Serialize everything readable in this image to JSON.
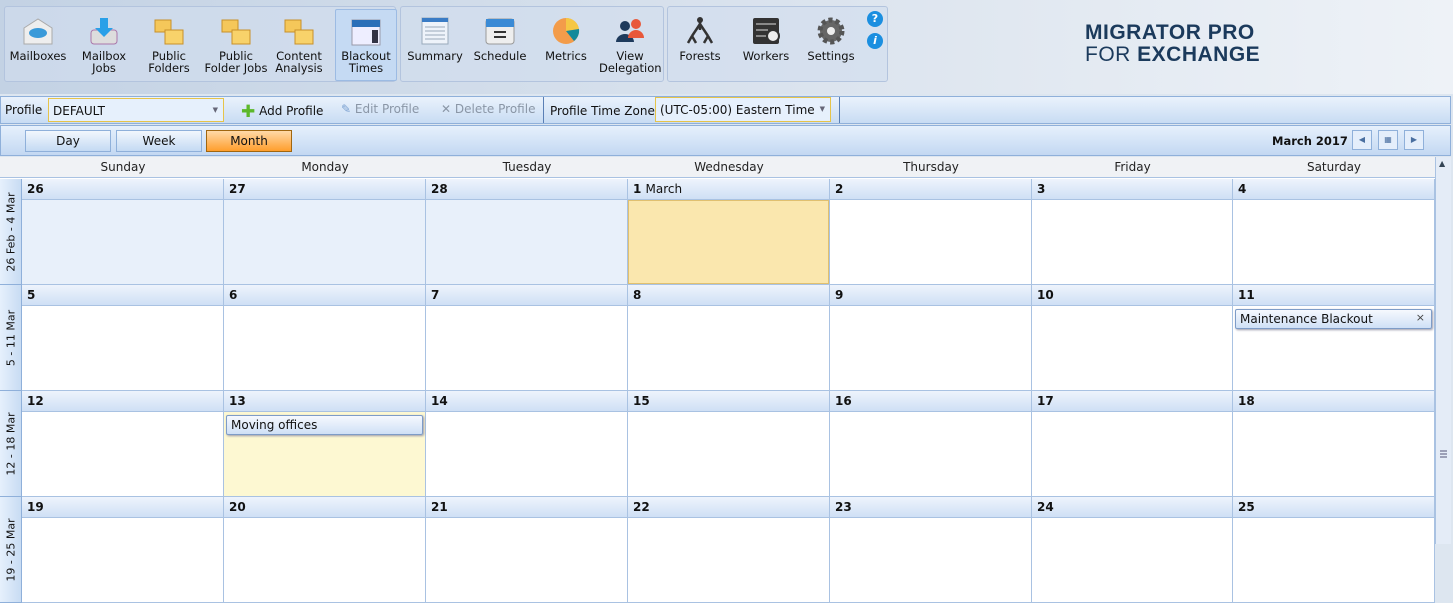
{
  "toolbar": {
    "groups": [
      [
        {
          "label": "Mailboxes",
          "icon": "mailbox-icon"
        },
        {
          "label": "Mailbox Jobs",
          "icon": "mailbox-jobs-icon"
        },
        {
          "label": "Public Folders",
          "icon": "public-folders-icon"
        },
        {
          "label": "Public Folder Jobs",
          "icon": "public-folder-jobs-icon"
        },
        {
          "label": "Content Analysis",
          "icon": "content-analysis-icon"
        },
        {
          "label": "Blackout Times",
          "icon": "calendar-icon",
          "active": true
        }
      ],
      [
        {
          "label": "Summary",
          "icon": "summary-icon"
        },
        {
          "label": "Schedule",
          "icon": "schedule-icon"
        },
        {
          "label": "Metrics",
          "icon": "pie-chart-icon"
        },
        {
          "label": "View Delegation",
          "icon": "users-icon"
        }
      ],
      [
        {
          "label": "Forests",
          "icon": "forest-tree-icon"
        },
        {
          "label": "Workers",
          "icon": "workers-server-icon"
        },
        {
          "label": "Settings",
          "icon": "gear-icon"
        }
      ]
    ],
    "help": "?",
    "info": "i",
    "logo_line1": "MIGRATOR PRO",
    "logo_line2a": "FOR ",
    "logo_line2b": "EXCHANGE"
  },
  "profile": {
    "label": "Profile",
    "value": "DEFAULT",
    "add": "Add Profile",
    "edit": "Edit Profile",
    "delete": "Delete Profile",
    "tz_label": "Profile Time Zone",
    "tz_value": "(UTC-05:00) Eastern Time"
  },
  "view": {
    "day": "Day",
    "week": "Week",
    "month": "Month",
    "selected": "Month",
    "title": "March 2017"
  },
  "calendar": {
    "days": [
      "Sunday",
      "Monday",
      "Tuesday",
      "Wednesday",
      "Thursday",
      "Friday",
      "Saturday"
    ],
    "weeks": [
      {
        "label": "26 Feb - 4 Mar",
        "dates": [
          "26",
          "27",
          "28",
          "1",
          "2",
          "3",
          "4"
        ],
        "other": [
          0,
          1,
          2
        ]
      },
      {
        "label": "5 - 11 Mar",
        "dates": [
          "5",
          "6",
          "7",
          "8",
          "9",
          "10",
          "11"
        ],
        "other": []
      },
      {
        "label": "12 - 18 Mar",
        "dates": [
          "12",
          "13",
          "14",
          "15",
          "16",
          "17",
          "18"
        ],
        "other": []
      },
      {
        "label": "19 - 25 Mar",
        "dates": [
          "19",
          "20",
          "21",
          "22",
          "23",
          "24",
          "25"
        ],
        "other": []
      }
    ],
    "first_month_suffix": "March",
    "today": {
      "week": 0,
      "day": 3
    },
    "appointments": [
      {
        "title": "Maintenance Blackout",
        "week": 1,
        "day": 6,
        "close": "×"
      },
      {
        "title": "Moving offices",
        "week": 2,
        "day": 1,
        "highlight": true
      }
    ],
    "colors": {
      "today": "#fae7ae",
      "highlight": "#fdf8d2",
      "other_month": "#e8f0fa",
      "accent": "#ff9e2c"
    }
  }
}
